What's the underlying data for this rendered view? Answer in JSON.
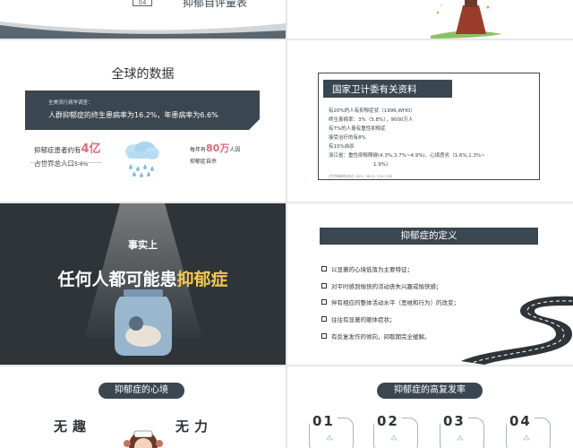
{
  "slides": {
    "s1": {
      "number": "04",
      "title": "抑郁自评量表"
    },
    "s3": {
      "title": "全球的数据",
      "band_small": "全美流行病学调查：",
      "band_big": "人群抑郁症的终生患病率为16.2%，年患病率为6.6%",
      "left_a": "抑郁症患者约有",
      "left_hl": "4亿",
      "left_b": "占世界总人口",
      "left_pct": "5-6%",
      "right_a": "每年有",
      "right_hl": "80万",
      "right_b": "人因",
      "right_c": "抑郁症自杀"
    },
    "s4": {
      "head": "国家卫计委有关资料",
      "lines": [
        "有20%的人有抑郁症状（1996,WHO）",
        "终生患病率：3%（5.8%），9000万人",
        "有7%的人患有重性抑郁症",
        "接受治疗的有8%",
        "有15%自杀",
        "浙江省：重性抑郁障碍(4.3%,3.7%~4.9%)、心境恶劣（1.6%,1.3%~",
        "1.9%)"
      ],
      "note": "[中华精神科杂志 2005, 38(4): 229-236]"
    },
    "s5": {
      "sub": "事实上",
      "main_a": "任何人都可能患",
      "main_hl": "抑郁症"
    },
    "s6": {
      "head": "抑郁症的定义",
      "items": [
        "以显著的心境低落为主要特征；",
        "对平时感到愉快的活动丧失兴趣或愉快感；",
        "伴有相应的整体活动水平（思维和行为）的改变；",
        "往往有显著的躯体症状；",
        "有反复发作的倾向，间歇期完全缓解。"
      ]
    },
    "s7": {
      "pill": "抑郁症的心境",
      "w1": "无趣",
      "w2": "无力"
    },
    "s8": {
      "pill": "抑郁症的高复发率",
      "cards": [
        "01",
        "02",
        "03",
        "04"
      ]
    }
  },
  "colors": {
    "dark": "#2e3438",
    "navy": "#3b4750",
    "pink": "#e0687d",
    "yellow": "#f2c94c"
  }
}
